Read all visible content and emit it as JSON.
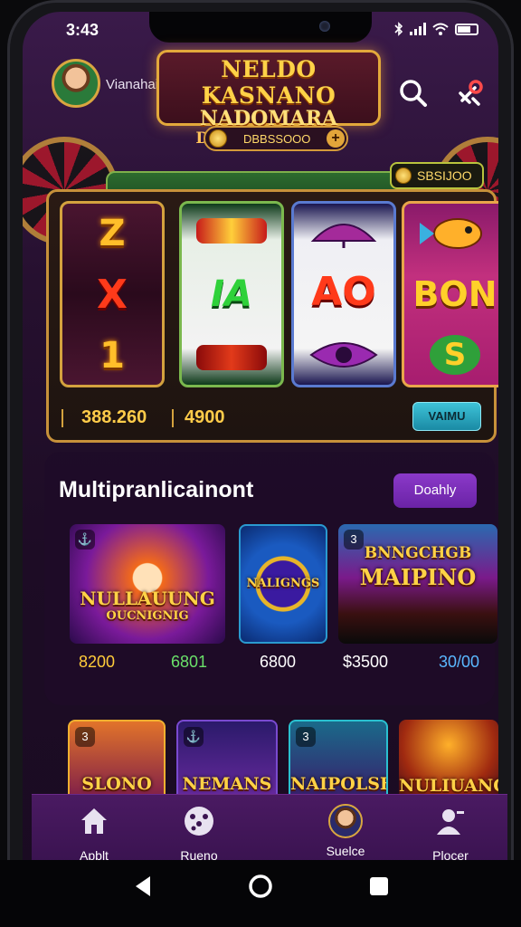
{
  "status": {
    "time": "3:43"
  },
  "header": {
    "username": "Vianahaisin",
    "logo_line1": "NELDO KASNANO",
    "logo_line2": "NADOMARA",
    "logo_line3": "DAERDSIAAGON",
    "coin_balance": "DBBSSOOO"
  },
  "slot": {
    "bonus_value": "SBSIJOO",
    "reel1": [
      "Z",
      "X",
      "1"
    ],
    "reel2_symbol": "IA",
    "reel3_symbol": "AO",
    "reel4_symbol": "BON",
    "reel4_sub": "S",
    "bet_value": "388.260",
    "win_value": "4900",
    "spin_label": "VAIMU"
  },
  "multiplayer": {
    "title": "Multipranlicainont",
    "daily_label": "Doahly",
    "games": [
      {
        "badge": "⚓",
        "banner": "NULLAUUNG",
        "banner_sub": "OUCNIGNIG"
      },
      {
        "badge": "",
        "banner": "NALIGNGS",
        "banner_sub": ""
      },
      {
        "badge": "3",
        "banner": "BNNGCHGB",
        "banner_sub": "MAIPINO"
      }
    ],
    "prices": [
      "8200",
      "6801",
      "6800",
      "$3500",
      "30/00"
    ]
  },
  "lower_games": [
    {
      "badge": "3",
      "banner": "SLONO"
    },
    {
      "badge": "⚓",
      "banner": "NEMANS"
    },
    {
      "badge": "3",
      "banner": "NAIPOLSH"
    },
    {
      "badge": "",
      "banner": "NULIUANG"
    }
  ],
  "nav": {
    "items": [
      {
        "label": "Apblt",
        "icon": "home-icon"
      },
      {
        "label": "Rueno",
        "icon": "dice-icon"
      },
      {
        "label": "Suelce",
        "icon": "profile-photo-icon"
      },
      {
        "label": "Plocer",
        "icon": "person-add-icon"
      }
    ]
  },
  "colors": {
    "accent_gold": "#ffcc4a",
    "accent_purple": "#8b39c9",
    "spin_teal": "#3ec3d8",
    "background": "#26102f"
  }
}
